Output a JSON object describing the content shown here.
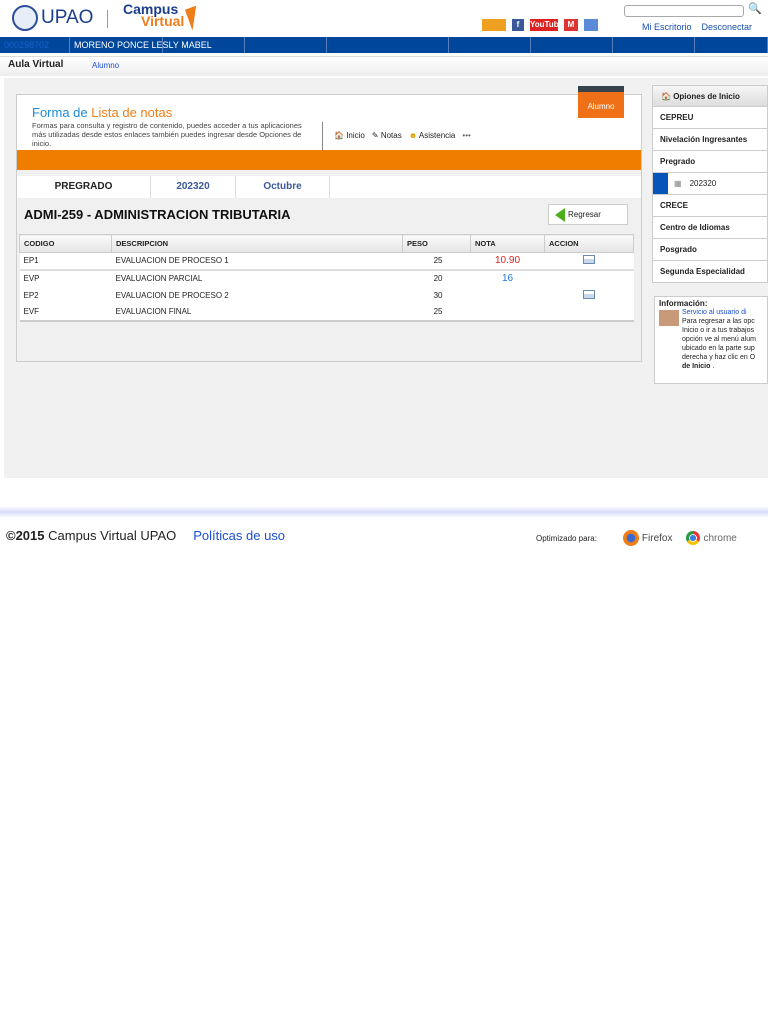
{
  "header": {
    "logo_text": "UPAO",
    "campus": "Campus",
    "virtual": "Virtual",
    "search_placeholder": "",
    "links": [
      "Mi Escritorio",
      "Desconectar"
    ],
    "social": [
      "RSS",
      "f",
      "YouTube",
      "M",
      "cal"
    ]
  },
  "navbar": {
    "student_id": "000298702",
    "student_name": "MORENO PONCE LESLY MABEL"
  },
  "subbar": {
    "title": "Aula Virtual",
    "role": "Alumno"
  },
  "form": {
    "title_prefix": "Forma de",
    "title": "Lista de notas",
    "description": "Formas para consulta y registro de contenido, puedes acceder a tus aplicaciones más utilizadas desde estos enlaces también puedes ingresar desde Opciones de inicio.",
    "quick_links": [
      "Inicio",
      "Notas",
      "Asistencia",
      "•••"
    ],
    "role_tab": "Alumno"
  },
  "tabs": [
    "PREGRADO",
    "202320",
    "Octubre"
  ],
  "course": {
    "title": "ADMI-259 - ADMINISTRACION TRIBUTARIA",
    "back_button": "Regresar"
  },
  "table": {
    "headers": [
      "CODIGO",
      "DESCRIPCION",
      "PESO",
      "NOTA",
      "ACCION"
    ],
    "rows": [
      {
        "codigo": "EP1",
        "descripcion": "EVALUACION DE PROCESO 1",
        "peso": "25",
        "nota": "10.90",
        "nota_color": "#e02020",
        "accion": true
      },
      {
        "codigo": "EVP",
        "descripcion": "EVALUACION PARCIAL",
        "peso": "20",
        "nota": "16",
        "nota_color": "#1e7ad8",
        "accion": false
      },
      {
        "codigo": "EP2",
        "descripcion": "EVALUACION DE PROCESO 2",
        "peso": "30",
        "nota": "",
        "accion": true
      },
      {
        "codigo": "EVF",
        "descripcion": "EVALUACION FINAL",
        "peso": "25",
        "nota": "",
        "accion": false
      }
    ]
  },
  "sidebar": {
    "title": "Opiones de Inicio",
    "items": [
      "CEPREU",
      "Nivelación Ingresantes",
      "Pregrado",
      "202320",
      "CRECE",
      "Centro de Idiomas",
      "Posgrado",
      "Segunda Especialidad"
    ]
  },
  "info": {
    "title": "Información:",
    "link": "Servicio al usuario di",
    "text": "Para regresar a las opc Inicio o ir a tus trabajos opción ve al menú alum ubicado en la parte sup derecha y haz clic en O",
    "bold": "de Inicio",
    "end": " ."
  },
  "footer": {
    "year": "©2015",
    "site": "Campus Virtual UPAO",
    "policy": "Políticas de uso",
    "optimized": "Optimizado para:",
    "browsers": [
      "Firefox",
      "chrome"
    ]
  }
}
